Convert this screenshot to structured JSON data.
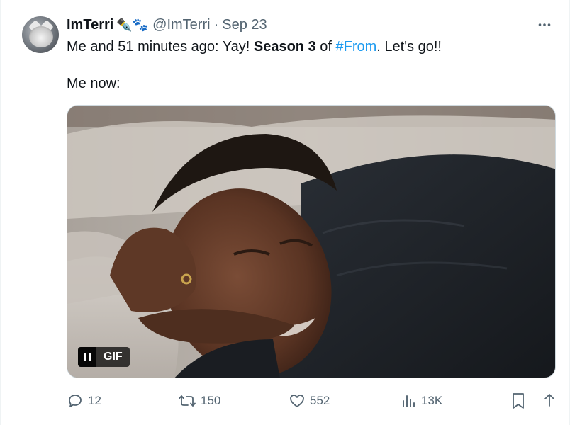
{
  "tweet": {
    "display_name": "ImTerri",
    "name_emojis": "✒️🐾",
    "handle": "@ImTerri",
    "separator": "·",
    "date": "Sep 23",
    "more_icon": "more-horizontal-icon",
    "text": {
      "line1_prefix": "Me and 51 minutes ago: Yay! ",
      "line1_bold": "Season 3",
      "line1_mid": " of ",
      "line1_hashtag": "#From",
      "line1_suffix": ". Let's go!!",
      "line2": "Me now:"
    },
    "media": {
      "type": "gif",
      "badge_label": "GIF",
      "pause_icon": "pause-icon"
    },
    "actions": {
      "reply_count": "12",
      "retweet_count": "150",
      "like_count": "552",
      "views_count": "13K"
    },
    "colors": {
      "accent": "#1d9bf0",
      "secondary_text": "#536471",
      "primary_text": "#0f1419"
    }
  }
}
